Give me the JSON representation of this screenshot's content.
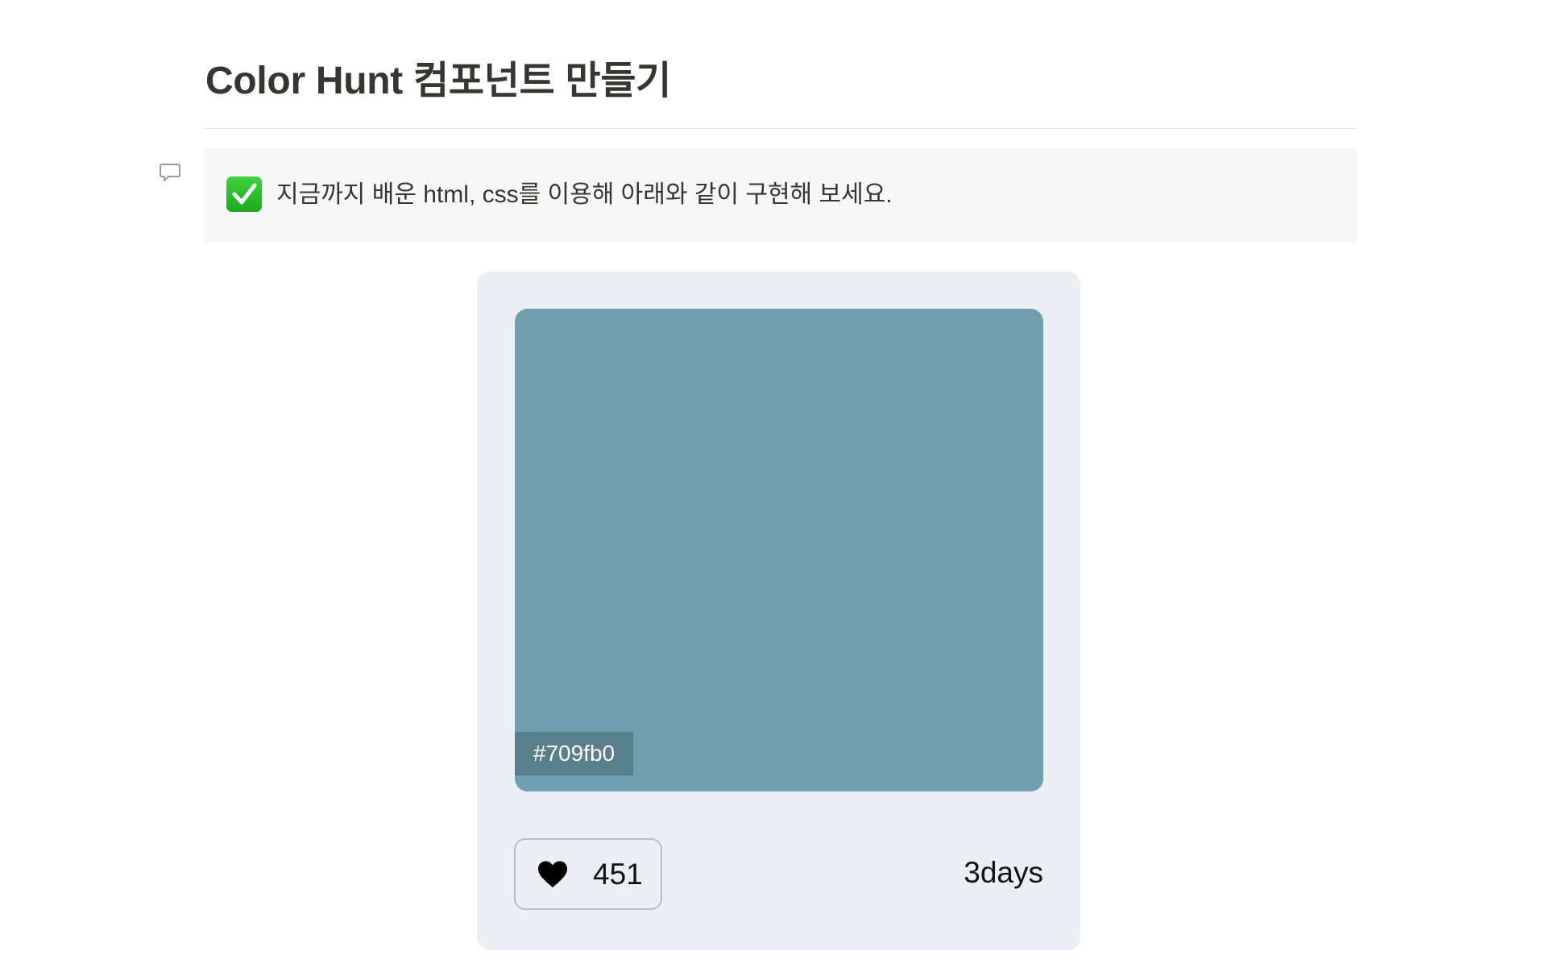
{
  "page": {
    "title": "Color Hunt 컴포넌트 만들기"
  },
  "callout": {
    "icon": "check-mark-icon",
    "text": "지금까지 배운 html, css를 이용해 아래와 같이 구현해 보세요."
  },
  "comment": {
    "icon": "comment-icon"
  },
  "card": {
    "swatch_color": "#709fb0",
    "hex_label": "#709fb0",
    "likes": "451",
    "like_icon": "heart-icon",
    "date": "3days"
  },
  "colors": {
    "card_background": "#ebeef3",
    "callout_background": "#f7f7f7",
    "title_text": "#37352f"
  }
}
